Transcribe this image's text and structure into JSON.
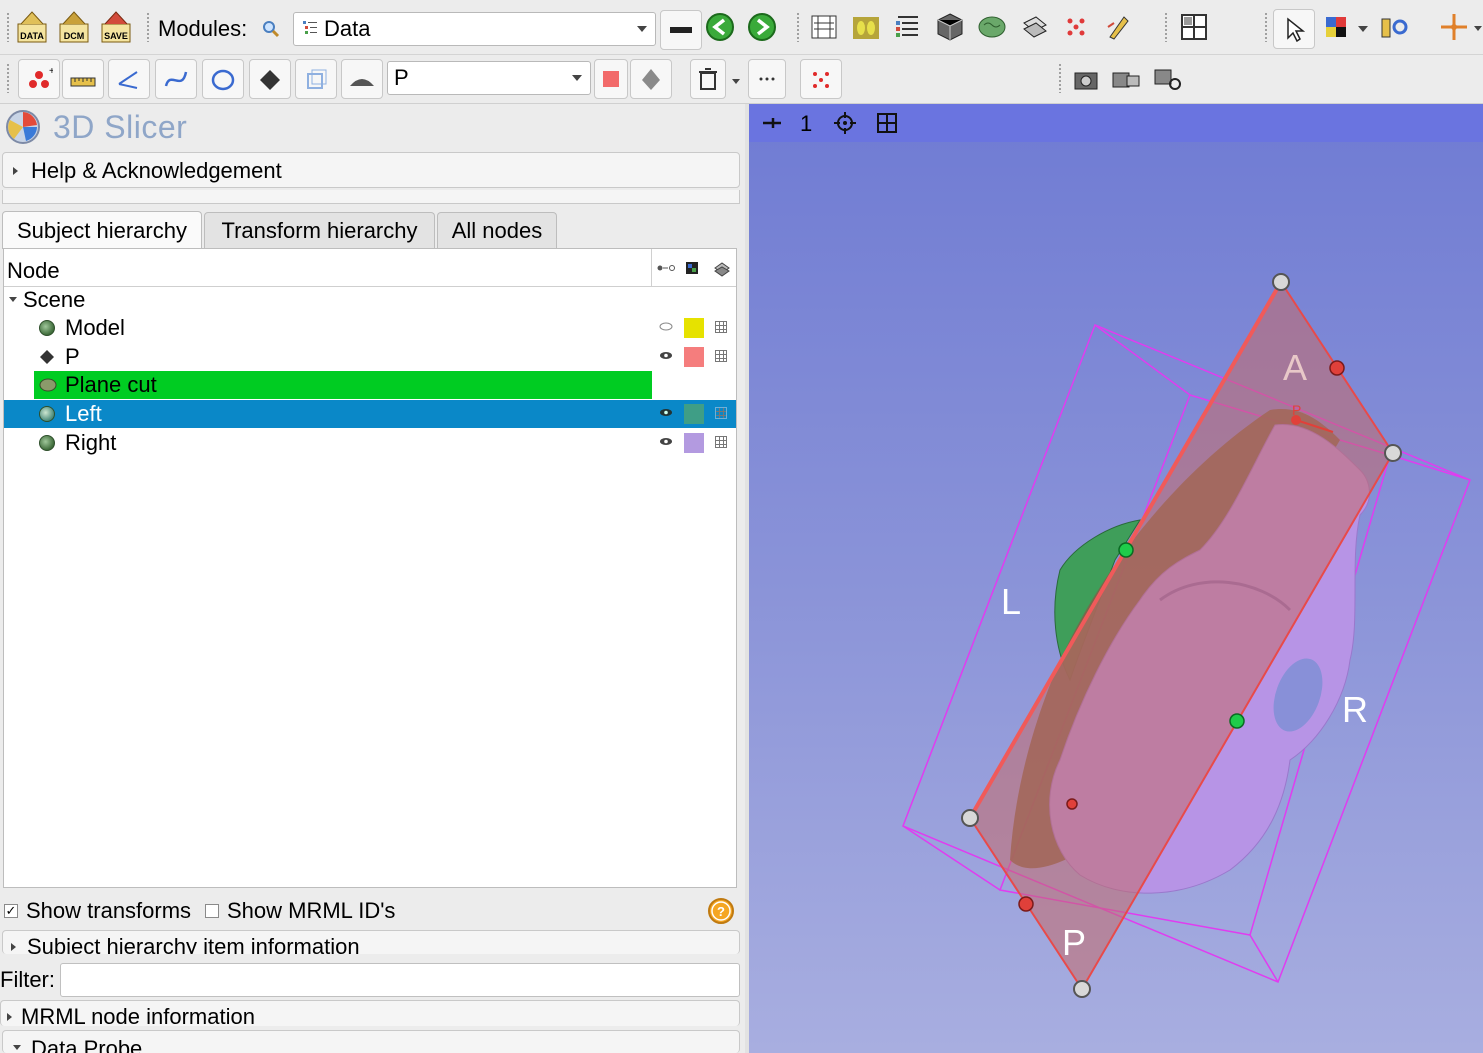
{
  "toolbar": {
    "modules_label": "Modules:",
    "module_selected": "Data",
    "markup_node_selected": "P",
    "icons": {
      "load_data": "DATA",
      "dicom": "DCM",
      "save": "SAVE"
    }
  },
  "app": {
    "title": "3D Slicer"
  },
  "sections": {
    "help": "Help & Acknowledgement",
    "subject_item_info": "Subject hierarchy item information",
    "mrml_info": "MRML node information",
    "data_probe": "Data Probe"
  },
  "tabs": [
    {
      "label": "Subject hierarchy",
      "active": true
    },
    {
      "label": "Transform hierarchy",
      "active": false
    },
    {
      "label": "All nodes",
      "active": false
    }
  ],
  "tree": {
    "header": "Node",
    "scene_label": "Scene",
    "rows": [
      {
        "label": "Model",
        "color": "#e6e200",
        "visible": false,
        "selected": false
      },
      {
        "label": "P",
        "color": "#f57d7d",
        "visible": true,
        "selected": false
      },
      {
        "label": "Plane cut",
        "color": "#00cc22",
        "visible": null,
        "selected": false
      },
      {
        "label": "Left",
        "color": "#3f9e86",
        "visible": true,
        "selected": true
      },
      {
        "label": "Right",
        "color": "#b39ae0",
        "visible": true,
        "selected": false
      }
    ]
  },
  "options": {
    "show_transforms": "Show transforms",
    "show_transforms_checked": true,
    "show_mrml_ids": "Show MRML ID's",
    "show_mrml_ids_checked": false
  },
  "filter": {
    "label": "Filter:",
    "value": ""
  },
  "viewer": {
    "view_number": "1",
    "labels": {
      "A": "A",
      "P": "P",
      "L": "L",
      "R": "R",
      "markup": "P"
    },
    "colors": {
      "background_top": "#6f7bd3",
      "plane": "#c46a6a",
      "model": "#b794e6",
      "box": "#e03cf0"
    }
  }
}
